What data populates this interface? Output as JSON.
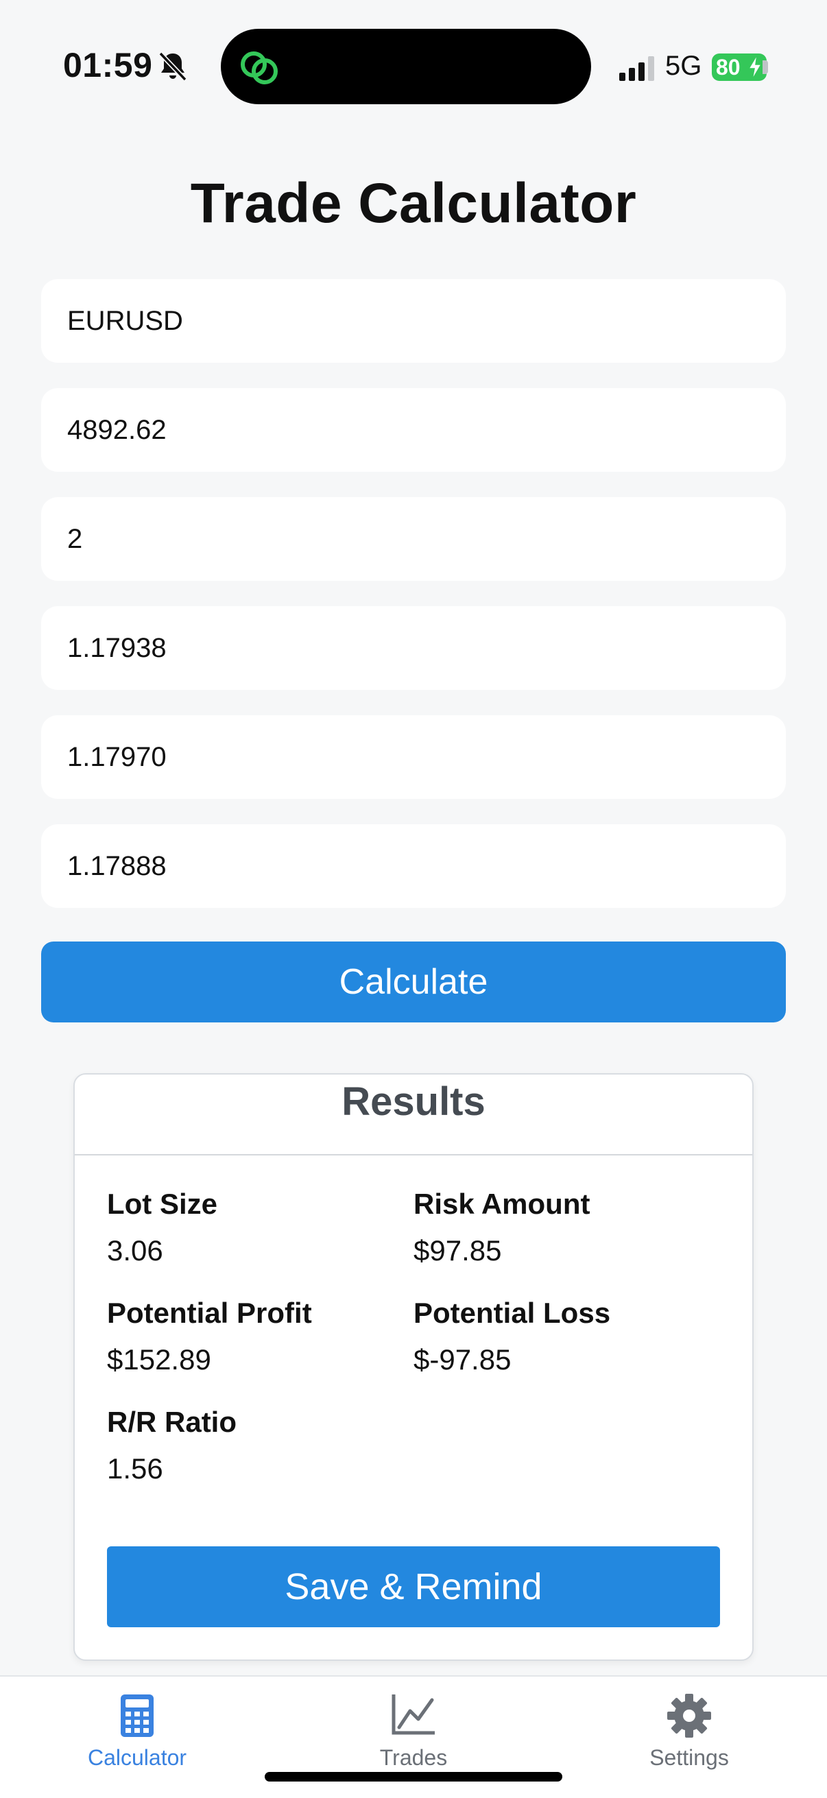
{
  "status_bar": {
    "time": "01:59",
    "network": "5G",
    "battery": "80"
  },
  "page": {
    "title": "Trade Calculator"
  },
  "form": {
    "symbol": "EURUSD",
    "balance": "4892.62",
    "risk_percent": "2",
    "entry_price": "1.17938",
    "take_profit": "1.17970",
    "stop_loss": "1.17888"
  },
  "calculate_button": "Calculate",
  "results": {
    "title": "Results",
    "lot_size_label": "Lot Size",
    "lot_size_value": "3.06",
    "risk_amount_label": "Risk Amount",
    "risk_amount_value": "$97.85",
    "potential_profit_label": "Potential Profit",
    "potential_profit_value": "$152.89",
    "potential_loss_label": "Potential Loss",
    "potential_loss_value": "$-97.85",
    "rr_ratio_label": "R/R Ratio",
    "rr_ratio_value": "1.56",
    "save_button": "Save & Remind"
  },
  "tabs": [
    {
      "label": "Calculator",
      "icon": "calculator-icon",
      "active": true
    },
    {
      "label": "Trades",
      "icon": "line-chart-icon",
      "active": false
    },
    {
      "label": "Settings",
      "icon": "gear-icon",
      "active": false
    }
  ],
  "colors": {
    "accent": "#2388df",
    "background": "#f6f7f8",
    "active_tab": "#3a82e0",
    "inactive_tab": "#6b7077",
    "battery": "#34c759",
    "app_logo": "#34c759"
  }
}
